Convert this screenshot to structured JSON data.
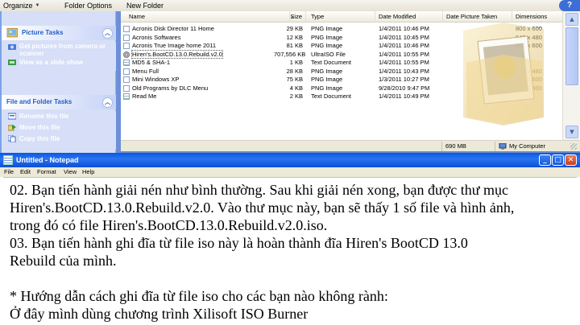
{
  "explorer": {
    "toolbar": {
      "organize": "Organize",
      "folder_options": "Folder Options",
      "new_folder": "New Folder"
    },
    "tasks": {
      "picture_tasks": {
        "title": "Picture Tasks",
        "links": [
          "Get pictures from camera or scanner",
          "View as a slide show"
        ]
      },
      "file_folder_tasks": {
        "title": "File and Folder Tasks",
        "links": [
          "Rename this file",
          "Move this file",
          "Copy this file"
        ]
      }
    },
    "columns": {
      "name": "Name",
      "size": "Size",
      "type": "Type",
      "date_modified": "Date Modified",
      "date_picture_taken": "Date Picture Taken",
      "dimensions": "Dimensions"
    },
    "files": [
      {
        "name": "Acronis Disk Director 11 Home",
        "size": "29 KB",
        "type": "PNG Image",
        "modified": "1/4/2011 10:46 PM",
        "dims": "800 x 600",
        "icon": "png-icon"
      },
      {
        "name": "Acronis Softwares",
        "size": "12 KB",
        "type": "PNG Image",
        "modified": "1/4/2011 10:45 PM",
        "dims": "640 x 480",
        "icon": "png-icon"
      },
      {
        "name": "Acronis True Image home 2011",
        "size": "81 KB",
        "type": "PNG Image",
        "modified": "1/4/2011 10:46 PM",
        "dims": "800 x 600",
        "icon": "png-icon"
      },
      {
        "name": "Hiren's.BootCD.13.0.Rebuild.v2.0",
        "size": "707,556 KB",
        "type": "UltraISO File",
        "modified": "1/4/2011 10:55 PM",
        "dims": "",
        "icon": "iso-icon"
      },
      {
        "name": "MD5 & SHA-1",
        "size": "1 KB",
        "type": "Text Document",
        "modified": "1/4/2011 10:55 PM",
        "dims": "",
        "icon": "text-icon"
      },
      {
        "name": "Menu Full",
        "size": "28 KB",
        "type": "PNG Image",
        "modified": "1/4/2011 10:43 PM",
        "dims": "640 x 480",
        "icon": "png-icon"
      },
      {
        "name": "Mini Windows XP",
        "size": "75 KB",
        "type": "PNG Image",
        "modified": "1/3/2011 10:27 PM",
        "dims": "800 x 600",
        "icon": "png-icon"
      },
      {
        "name": "Old Programs by DLC Menu",
        "size": "4 KB",
        "type": "PNG Image",
        "modified": "9/28/2010 9:47 PM",
        "dims": "720 x 400",
        "icon": "png-icon"
      },
      {
        "name": "Read Me",
        "size": "2 KB",
        "type": "Text Document",
        "modified": "1/4/2011 10:49 PM",
        "dims": "",
        "icon": "text-icon"
      }
    ],
    "status": {
      "size": "690 MB",
      "location": "My Computer"
    }
  },
  "notepad": {
    "title": "Untitled - Notepad",
    "menu": [
      "File",
      "Edit",
      "Format",
      "View",
      "Help"
    ],
    "lines": [
      "02. Bạn tiến hành giải nén như bình thường. Sau khi giải nén xong, bạn được thư mục",
      "Hiren's.BootCD.13.0.Rebuild.v2.0. Vào thư mục này, bạn sẽ thấy 1 số file và hình ảnh,",
      "trong đó có file Hiren's.BootCD.13.0.Rebuild.v2.0.iso.",
      "03. Bạn tiến hành ghi đĩa từ file iso này là hoàn thành đĩa Hiren's BootCD 13.0",
      "Rebuild của mình.",
      "",
      "* Hướng dẫn cách ghi đĩa từ file iso cho các bạn nào không rành:",
      "Ở đây mình dùng chương trình Xilisoft ISO Burner"
    ]
  },
  "colors": {
    "xp_blue": "#0a57e0",
    "task_pane": "#d6dff7",
    "task_link": "#ffffff"
  }
}
